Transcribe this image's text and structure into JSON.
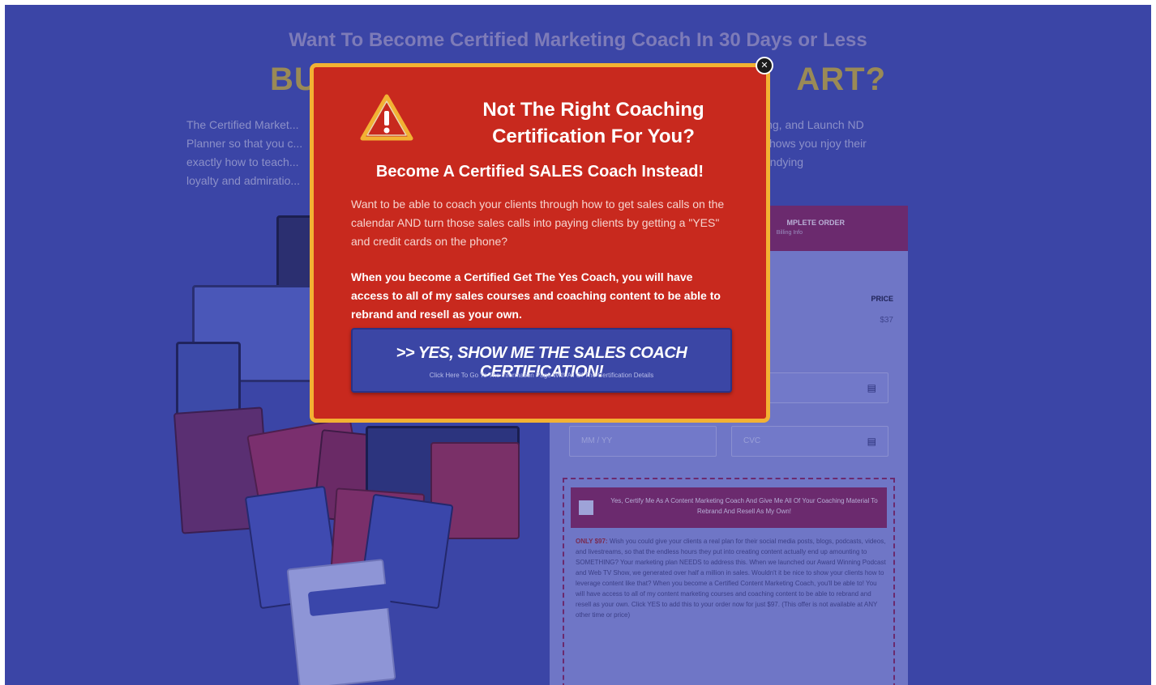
{
  "page": {
    "headline": "Want To Become Certified Marketing Coach In 30 Days or Less",
    "big_left": "BUT I",
    "big_right": "ART?",
    "intro_left": "The Certified Market... Planner so that you c... exactly how to teach... loyalty and admiratio...",
    "intro_right": "ing, and Launch ND shows you njoy their undying"
  },
  "order_panel": {
    "header_label": "MPLETE ORDER",
    "header_sub": "Billing Info",
    "price_label": "PRICE",
    "price_value": "$37",
    "fields": {
      "card_icon": "credit-card-icon",
      "expiry_placeholder": "MM / YY",
      "cvc_placeholder": "CVC"
    },
    "upsell_checkbox_text": "Yes, Certify Me As A Content Marketing Coach And Give Me All Of Your Coaching Material To Rebrand And Resell As My Own!",
    "upsell_lead": "ONLY $97:",
    "upsell_text": "Wish you could give your clients a real plan for their social media posts, blogs, podcasts, videos, and livestreams, so that the endless hours they put into creating content actually end up amounting to SOMETHING? Your marketing plan NEEDS to address this. When we launched our Award Winning Podcast and Web TV Show, we generated over half a million in sales. Wouldn't it be nice to show your clients how to leverage content like that? When you become a Certified Content Marketing Coach, you'll be able to! You will have access to all of my content marketing courses and coaching content to be able to rebrand and resell as your own. Click YES to add this to your order now for just $97. (This offer is not available at ANY other time or price)"
  },
  "popup": {
    "close_icon": "close-icon",
    "warning_icon": "warning-icon",
    "title": "Not The Right Coaching Certification For You?",
    "subtitle": "Become A Certified SALES Coach Instead!",
    "body": "Want to be able to coach your clients through how to get sales calls on the calendar AND turn those sales calls into paying clients by getting a \"YES\" and credit cards on the phone?",
    "bold": "When you become a Certified Get The Yes Coach, you will have access to all of my sales courses and coaching content to be able to rebrand and resell as your own.",
    "cta_main": ">> YES, SHOW ME THE SALES COACH CERTIFICATION!",
    "cta_sub": "Click Here To Go To The Information Page With All Of The Certification Details"
  },
  "colors": {
    "overlay_blue": "#3b45a6",
    "popup_red": "#c8291e",
    "popup_border": "#f2b233",
    "cta_blue": "#3b46a5"
  }
}
